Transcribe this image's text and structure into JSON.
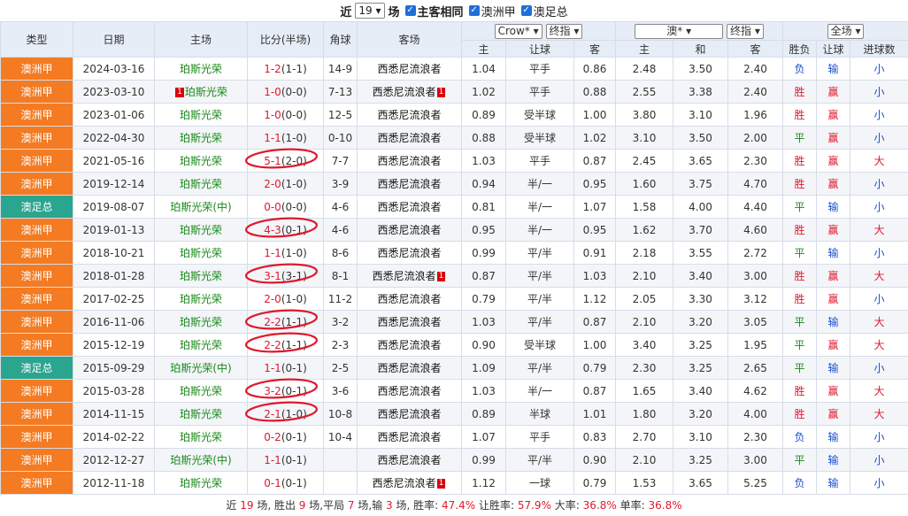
{
  "topbar": {
    "prefix": "近",
    "count_value": "19",
    "unit": "场",
    "opt1": "主客相同",
    "opt2": "澳洲甲",
    "opt3": "澳足总"
  },
  "headers": {
    "type": "类型",
    "date": "日期",
    "home": "主场",
    "score": "比分(半场)",
    "corner": "角球",
    "away": "客场",
    "co1_select": "Crow*",
    "co1_mode": "终指",
    "co2_select": "澳*",
    "co2_mode": "终指",
    "scope": "全场",
    "sub_home": "主",
    "sub_handicap": "让球",
    "sub_away": "客",
    "sub_home2": "主",
    "sub_draw": "和",
    "sub_away2": "客",
    "sub_result": "胜负",
    "sub_hresult": "让球",
    "sub_goals": "进球数"
  },
  "colors": {
    "league_orange": "#f47b22",
    "league_teal": "#2aa58f",
    "win": "#e0182d",
    "draw": "#1a8a1a",
    "loss": "#1a4fd1",
    "annotation": "#e0182d"
  },
  "rows": [
    {
      "type": "澳洲甲",
      "date": "2024-03-16",
      "home": "珀斯光荣",
      "home_rc": "",
      "score": "1-2",
      "half": "(1-1)",
      "corner": "14-9",
      "away": "西悉尼流浪者",
      "away_rc": "",
      "o_h": "1.04",
      "o_hc": "平手",
      "o_a": "0.86",
      "e_h": "2.48",
      "e_d": "3.50",
      "e_a": "2.40",
      "res": "负",
      "hres": "输",
      "goals": "小"
    },
    {
      "type": "澳洲甲",
      "date": "2023-03-10",
      "home": "珀斯光荣",
      "home_rc": "1",
      "score": "1-0",
      "half": "(0-0)",
      "corner": "7-13",
      "away": "西悉尼流浪者",
      "away_rc": "1",
      "o_h": "1.02",
      "o_hc": "平手",
      "o_a": "0.88",
      "e_h": "2.55",
      "e_d": "3.38",
      "e_a": "2.40",
      "res": "胜",
      "hres": "赢",
      "goals": "小"
    },
    {
      "type": "澳洲甲",
      "date": "2023-01-06",
      "home": "珀斯光荣",
      "home_rc": "",
      "score": "1-0",
      "half": "(0-0)",
      "corner": "12-5",
      "away": "西悉尼流浪者",
      "away_rc": "",
      "o_h": "0.89",
      "o_hc": "受半球",
      "o_a": "1.00",
      "e_h": "3.80",
      "e_d": "3.10",
      "e_a": "1.96",
      "res": "胜",
      "hres": "赢",
      "goals": "小"
    },
    {
      "type": "澳洲甲",
      "date": "2022-04-30",
      "home": "珀斯光荣",
      "home_rc": "",
      "score": "1-1",
      "half": "(1-0)",
      "corner": "0-10",
      "away": "西悉尼流浪者",
      "away_rc": "",
      "o_h": "0.88",
      "o_hc": "受半球",
      "o_a": "1.02",
      "e_h": "3.10",
      "e_d": "3.50",
      "e_a": "2.00",
      "res": "平",
      "hres": "赢",
      "goals": "小"
    },
    {
      "type": "澳洲甲",
      "date": "2021-05-16",
      "home": "珀斯光荣",
      "home_rc": "",
      "score": "5-1",
      "half": "(2-0)",
      "corner": "7-7",
      "away": "西悉尼流浪者",
      "away_rc": "",
      "o_h": "1.03",
      "o_hc": "平手",
      "o_a": "0.87",
      "e_h": "2.45",
      "e_d": "3.65",
      "e_a": "2.30",
      "res": "胜",
      "hres": "赢",
      "goals": "大"
    },
    {
      "type": "澳洲甲",
      "date": "2019-12-14",
      "home": "珀斯光荣",
      "home_rc": "",
      "score": "2-0",
      "half": "(1-0)",
      "corner": "3-9",
      "away": "西悉尼流浪者",
      "away_rc": "",
      "o_h": "0.94",
      "o_hc": "半/一",
      "o_a": "0.95",
      "e_h": "1.60",
      "e_d": "3.75",
      "e_a": "4.70",
      "res": "胜",
      "hres": "赢",
      "goals": "小"
    },
    {
      "type": "澳足总",
      "date": "2019-08-07",
      "home": "珀斯光荣(中)",
      "home_rc": "",
      "score": "0-0",
      "half": "(0-0)",
      "corner": "4-6",
      "away": "西悉尼流浪者",
      "away_rc": "",
      "o_h": "0.81",
      "o_hc": "半/一",
      "o_a": "1.07",
      "e_h": "1.58",
      "e_d": "4.00",
      "e_a": "4.40",
      "res": "平",
      "hres": "输",
      "goals": "小"
    },
    {
      "type": "澳洲甲",
      "date": "2019-01-13",
      "home": "珀斯光荣",
      "home_rc": "",
      "score": "4-3",
      "half": "(0-1)",
      "corner": "4-6",
      "away": "西悉尼流浪者",
      "away_rc": "",
      "o_h": "0.95",
      "o_hc": "半/一",
      "o_a": "0.95",
      "e_h": "1.62",
      "e_d": "3.70",
      "e_a": "4.60",
      "res": "胜",
      "hres": "赢",
      "goals": "大"
    },
    {
      "type": "澳洲甲",
      "date": "2018-10-21",
      "home": "珀斯光荣",
      "home_rc": "",
      "score": "1-1",
      "half": "(1-0)",
      "corner": "8-6",
      "away": "西悉尼流浪者",
      "away_rc": "",
      "o_h": "0.99",
      "o_hc": "平/半",
      "o_a": "0.91",
      "e_h": "2.18",
      "e_d": "3.55",
      "e_a": "2.72",
      "res": "平",
      "hres": "输",
      "goals": "小"
    },
    {
      "type": "澳洲甲",
      "date": "2018-01-28",
      "home": "珀斯光荣",
      "home_rc": "",
      "score": "3-1",
      "half": "(3-1)",
      "corner": "8-1",
      "away": "西悉尼流浪者",
      "away_rc": "1",
      "o_h": "0.87",
      "o_hc": "平/半",
      "o_a": "1.03",
      "e_h": "2.10",
      "e_d": "3.40",
      "e_a": "3.00",
      "res": "胜",
      "hres": "赢",
      "goals": "大"
    },
    {
      "type": "澳洲甲",
      "date": "2017-02-25",
      "home": "珀斯光荣",
      "home_rc": "",
      "score": "2-0",
      "half": "(1-0)",
      "corner": "11-2",
      "away": "西悉尼流浪者",
      "away_rc": "",
      "o_h": "0.79",
      "o_hc": "平/半",
      "o_a": "1.12",
      "e_h": "2.05",
      "e_d": "3.30",
      "e_a": "3.12",
      "res": "胜",
      "hres": "赢",
      "goals": "小"
    },
    {
      "type": "澳洲甲",
      "date": "2016-11-06",
      "home": "珀斯光荣",
      "home_rc": "",
      "score": "2-2",
      "half": "(1-1)",
      "corner": "3-2",
      "away": "西悉尼流浪者",
      "away_rc": "",
      "o_h": "1.03",
      "o_hc": "平/半",
      "o_a": "0.87",
      "e_h": "2.10",
      "e_d": "3.20",
      "e_a": "3.05",
      "res": "平",
      "hres": "输",
      "goals": "大"
    },
    {
      "type": "澳洲甲",
      "date": "2015-12-19",
      "home": "珀斯光荣",
      "home_rc": "",
      "score": "2-2",
      "half": "(1-1)",
      "corner": "2-3",
      "away": "西悉尼流浪者",
      "away_rc": "",
      "o_h": "0.90",
      "o_hc": "受半球",
      "o_a": "1.00",
      "e_h": "3.40",
      "e_d": "3.25",
      "e_a": "1.95",
      "res": "平",
      "hres": "赢",
      "goals": "大"
    },
    {
      "type": "澳足总",
      "date": "2015-09-29",
      "home": "珀斯光荣(中)",
      "home_rc": "",
      "score": "1-1",
      "half": "(0-1)",
      "corner": "2-5",
      "away": "西悉尼流浪者",
      "away_rc": "",
      "o_h": "1.09",
      "o_hc": "平/半",
      "o_a": "0.79",
      "e_h": "2.30",
      "e_d": "3.25",
      "e_a": "2.65",
      "res": "平",
      "hres": "输",
      "goals": "小"
    },
    {
      "type": "澳洲甲",
      "date": "2015-03-28",
      "home": "珀斯光荣",
      "home_rc": "",
      "score": "3-2",
      "half": "(0-1)",
      "corner": "3-6",
      "away": "西悉尼流浪者",
      "away_rc": "",
      "o_h": "1.03",
      "o_hc": "半/一",
      "o_a": "0.87",
      "e_h": "1.65",
      "e_d": "3.40",
      "e_a": "4.62",
      "res": "胜",
      "hres": "赢",
      "goals": "大"
    },
    {
      "type": "澳洲甲",
      "date": "2014-11-15",
      "home": "珀斯光荣",
      "home_rc": "",
      "score": "2-1",
      "half": "(1-0)",
      "corner": "10-8",
      "away": "西悉尼流浪者",
      "away_rc": "",
      "o_h": "0.89",
      "o_hc": "半球",
      "o_a": "1.01",
      "e_h": "1.80",
      "e_d": "3.20",
      "e_a": "4.00",
      "res": "胜",
      "hres": "赢",
      "goals": "大"
    },
    {
      "type": "澳洲甲",
      "date": "2014-02-22",
      "home": "珀斯光荣",
      "home_rc": "",
      "score": "0-2",
      "half": "(0-1)",
      "corner": "10-4",
      "away": "西悉尼流浪者",
      "away_rc": "",
      "o_h": "1.07",
      "o_hc": "平手",
      "o_a": "0.83",
      "e_h": "2.70",
      "e_d": "3.10",
      "e_a": "2.30",
      "res": "负",
      "hres": "输",
      "goals": "小"
    },
    {
      "type": "澳洲甲",
      "date": "2012-12-27",
      "home": "珀斯光荣(中)",
      "home_rc": "",
      "score": "1-1",
      "half": "(0-1)",
      "corner": "",
      "away": "西悉尼流浪者",
      "away_rc": "",
      "o_h": "0.99",
      "o_hc": "平/半",
      "o_a": "0.90",
      "e_h": "2.10",
      "e_d": "3.25",
      "e_a": "3.00",
      "res": "平",
      "hres": "输",
      "goals": "小"
    },
    {
      "type": "澳洲甲",
      "date": "2012-11-18",
      "home": "珀斯光荣",
      "home_rc": "",
      "score": "0-1",
      "half": "(0-1)",
      "corner": "",
      "away": "西悉尼流浪者",
      "away_rc": "1",
      "o_h": "1.12",
      "o_hc": "一球",
      "o_a": "0.79",
      "e_h": "1.53",
      "e_d": "3.65",
      "e_a": "5.25",
      "res": "负",
      "hres": "输",
      "goals": "小"
    }
  ],
  "summary": {
    "t1": "近",
    "n_games": "19",
    "t2": "场, 胜出",
    "wins": "9",
    "t3": "场,平局",
    "draws": "7",
    "t4": "场,输",
    "losses": "3",
    "t5": "场, 胜率:",
    "win_rate": "47.4%",
    "t6": "让胜率:",
    "hc_rate": "57.9%",
    "t7": "大率:",
    "big_rate": "36.8%",
    "t8": "单率:",
    "odd_rate": "36.8%"
  }
}
